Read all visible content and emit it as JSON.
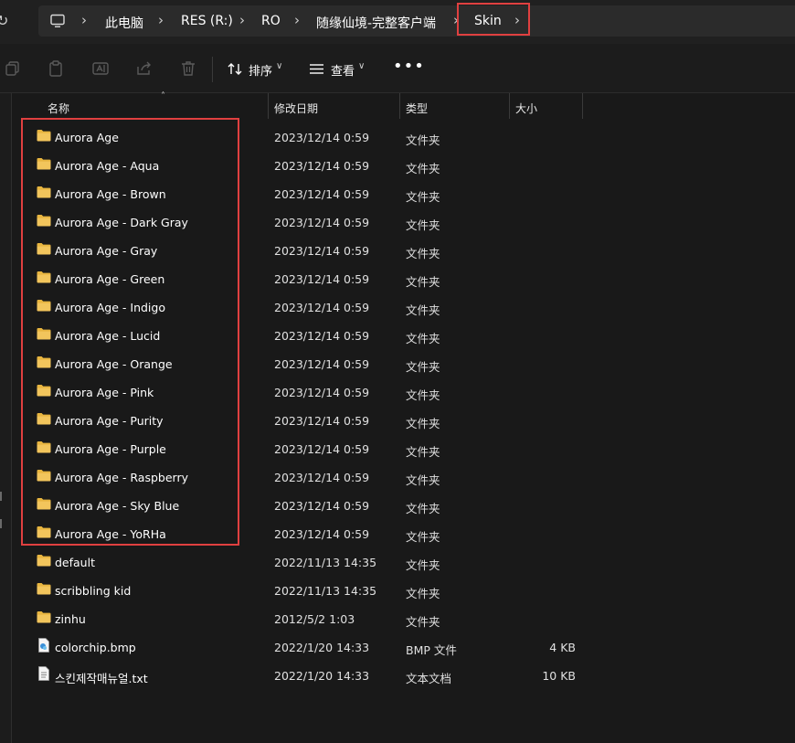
{
  "breadcrumb": {
    "items": [
      "此电脑",
      "RES (R:)",
      "RO",
      "随缘仙境-完整客户端",
      "Skin"
    ],
    "highlight_color": "#e04040"
  },
  "toolbar": {
    "sort_label": "排序",
    "view_label": "查看",
    "icons": [
      "copy-icon",
      "paste-icon",
      "rename-icon",
      "share-icon",
      "delete-icon"
    ]
  },
  "columns": {
    "name": "名称",
    "date": "修改日期",
    "type": "类型",
    "size": "大小"
  },
  "files": [
    {
      "name": "Aurora Age",
      "date": "2023/12/14 0:59",
      "type": "文件夹",
      "size": "",
      "icon": "folder-icon"
    },
    {
      "name": "Aurora Age - Aqua",
      "date": "2023/12/14 0:59",
      "type": "文件夹",
      "size": "",
      "icon": "folder-icon"
    },
    {
      "name": "Aurora Age - Brown",
      "date": "2023/12/14 0:59",
      "type": "文件夹",
      "size": "",
      "icon": "folder-icon"
    },
    {
      "name": "Aurora Age - Dark Gray",
      "date": "2023/12/14 0:59",
      "type": "文件夹",
      "size": "",
      "icon": "folder-icon"
    },
    {
      "name": "Aurora Age - Gray",
      "date": "2023/12/14 0:59",
      "type": "文件夹",
      "size": "",
      "icon": "folder-icon"
    },
    {
      "name": "Aurora Age - Green",
      "date": "2023/12/14 0:59",
      "type": "文件夹",
      "size": "",
      "icon": "folder-icon"
    },
    {
      "name": "Aurora Age - Indigo",
      "date": "2023/12/14 0:59",
      "type": "文件夹",
      "size": "",
      "icon": "folder-icon"
    },
    {
      "name": "Aurora Age - Lucid",
      "date": "2023/12/14 0:59",
      "type": "文件夹",
      "size": "",
      "icon": "folder-icon"
    },
    {
      "name": "Aurora Age - Orange",
      "date": "2023/12/14 0:59",
      "type": "文件夹",
      "size": "",
      "icon": "folder-icon"
    },
    {
      "name": "Aurora Age - Pink",
      "date": "2023/12/14 0:59",
      "type": "文件夹",
      "size": "",
      "icon": "folder-icon"
    },
    {
      "name": "Aurora Age - Purity",
      "date": "2023/12/14 0:59",
      "type": "文件夹",
      "size": "",
      "icon": "folder-icon"
    },
    {
      "name": "Aurora Age - Purple",
      "date": "2023/12/14 0:59",
      "type": "文件夹",
      "size": "",
      "icon": "folder-icon"
    },
    {
      "name": "Aurora Age - Raspberry",
      "date": "2023/12/14 0:59",
      "type": "文件夹",
      "size": "",
      "icon": "folder-icon"
    },
    {
      "name": "Aurora Age - Sky Blue",
      "date": "2023/12/14 0:59",
      "type": "文件夹",
      "size": "",
      "icon": "folder-icon"
    },
    {
      "name": "Aurora Age - YoRHa",
      "date": "2023/12/14 0:59",
      "type": "文件夹",
      "size": "",
      "icon": "folder-icon"
    },
    {
      "name": "default",
      "date": "2022/11/13 14:35",
      "type": "文件夹",
      "size": "",
      "icon": "folder-icon"
    },
    {
      "name": "scribbling kid",
      "date": "2022/11/13 14:35",
      "type": "文件夹",
      "size": "",
      "icon": "folder-icon"
    },
    {
      "name": "zinhu",
      "date": "2012/5/2 1:03",
      "type": "文件夹",
      "size": "",
      "icon": "folder-icon"
    },
    {
      "name": "colorchip.bmp",
      "date": "2022/1/20 14:33",
      "type": "BMP 文件",
      "size": "4 KB",
      "icon": "bmp-file-icon"
    },
    {
      "name": "스킨제작매뉴얼.txt",
      "date": "2022/1/20 14:33",
      "type": "文本文档",
      "size": "10 KB",
      "icon": "text-file-icon"
    }
  ],
  "colors": {
    "background": "#191919",
    "folder": "#f2c55c",
    "annotation": "#e04040"
  }
}
